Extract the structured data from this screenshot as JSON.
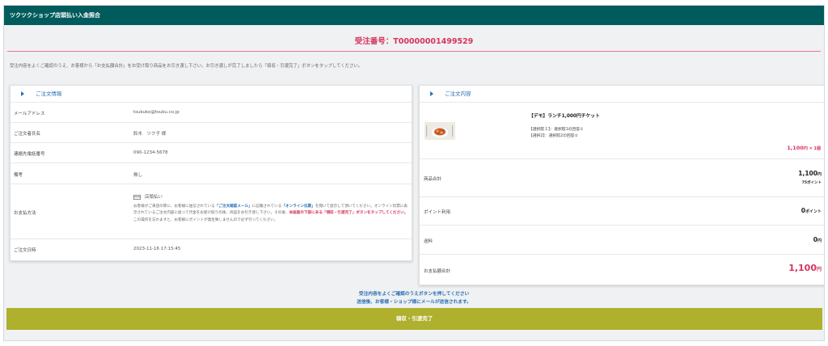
{
  "header": {
    "title": "ツクツクショップ店頭払い入金照合"
  },
  "order": {
    "number_label": "受注番号：T00000001499529"
  },
  "instruction": "受注内容をよくご確認のうえ、お客様から「お支払額合計」をお受け取り商品をお引き渡し下さい。お引き渡しが完了しましたら「領収・引渡完了」ボタンをタップしてください。",
  "order_info": {
    "title": "ご注文情報",
    "email_label": "メールアドレス",
    "email": "tsukuko@tsuku.co.jp",
    "name_label": "ご注文者氏名",
    "name": "鈴木　ツク子 様",
    "phone_label": "連絡先電話番号",
    "phone": "090-1234-5678",
    "remarks_label": "備考",
    "remarks": "無し",
    "payment_label": "お支払方法",
    "payment_method": "店頭払い",
    "payment_note_1": "お客様がご来店の際に、お客様に送信されている",
    "payment_note_link1": "「ご注文確認メール」",
    "payment_note_2": "に記載されている",
    "payment_note_link2": "「オンライン伝票」",
    "payment_note_3": "を開いて提示して頂いてください。オンライン伝票に表示されているご注文内容に従って代金をお受け取りの後、商品をお引き渡し下さい。その後、",
    "payment_note_red": "本画面の下部にある「領収・引渡完了」ボタンをタップしてください。",
    "payment_note_4": "この操作を忘れますと、お客様にポイントが発生致しませんので必ず行ってください。",
    "date_label": "ご注文日時",
    "date": "2023-11-16 17:15:45"
  },
  "order_content": {
    "title": "ご注文内容",
    "item_name": "【デモ】ランチ1,000円チケット",
    "option1": "【選択肢１】：選択肢1の回答①",
    "option2": "【選択2】：選択肢2の回答②",
    "item_price": "1,100",
    "item_price_unit": "円 × 1個",
    "subtotal_label": "商品合計",
    "subtotal": "1,100",
    "subtotal_unit": "円",
    "points_earned": "75ポイント",
    "points_used_label": "ポイント利用",
    "points_used": "0",
    "points_used_unit": "ポイント",
    "shipping_label": "送料",
    "shipping": "0",
    "shipping_unit": "円",
    "total_label": "お支払額合計",
    "total": "1,100",
    "total_unit": "円"
  },
  "bottom_note": {
    "line1": "受注内容をよくご確認のうえボタンを押してください",
    "line2": "送信後、お客様・ショップ様にメールが送信されます。"
  },
  "complete_button": "領収・引渡完了",
  "colors": {
    "header_bg": "#005c5c",
    "accent_red": "#d6345e",
    "link_blue": "#2a6fb5",
    "button": "#aeb02e"
  }
}
